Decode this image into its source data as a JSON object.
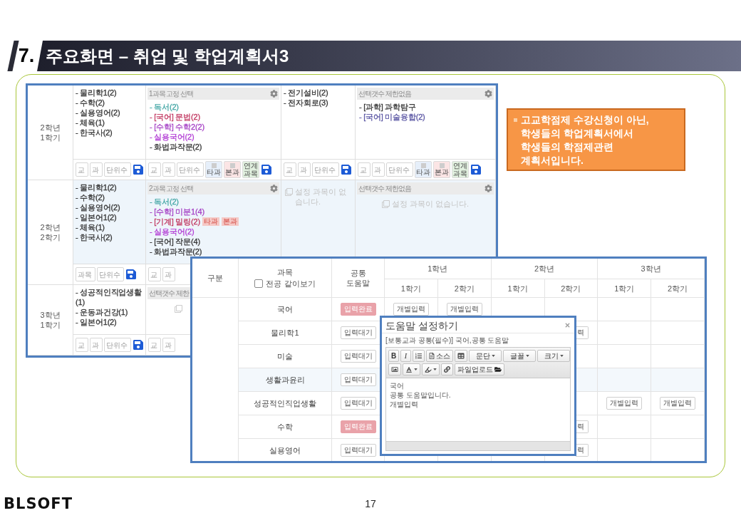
{
  "title": {
    "number": "7.",
    "text": "주요화면 – 취업 및 학업계획서3"
  },
  "planner": {
    "rows": [
      {
        "label": "2학년 1학기",
        "selected": false,
        "cells": [
          {
            "kind": "list",
            "items": [
              {
                "text": "- 물리학1(2)"
              },
              {
                "text": "- 수학(2)"
              },
              {
                "text": "- 실용영어(2)"
              },
              {
                "text": "- 체육(1)"
              },
              {
                "text": "- 한국사(2)"
              }
            ],
            "tools": [
              {
                "kind": "input",
                "placeholder": "교"
              },
              {
                "kind": "input",
                "placeholder": "과"
              },
              {
                "kind": "input",
                "placeholder": "단위수"
              },
              {
                "kind": "save"
              }
            ]
          },
          {
            "kind": "group",
            "header": "1과목 고정 선택",
            "items": [
              {
                "text": "- 독서(2)",
                "color": "#45a7a6"
              },
              {
                "text": "- [국어] 문법(2)",
                "color": "#c0355f"
              },
              {
                "text": "- [수학] 수학2(2)",
                "color": "#a43fc4"
              },
              {
                "text": "- 실용국어(2)",
                "color": "#b13cd4"
              },
              {
                "text": "- 화법과작문(2)",
                "color": "#333333"
              }
            ],
            "tools": [
              {
                "kind": "input",
                "placeholder": "교"
              },
              {
                "kind": "input",
                "placeholder": "과"
              },
              {
                "kind": "input",
                "placeholder": "단위수"
              },
              {
                "kind": "toggle",
                "label": "타과",
                "checked": false,
                "color": "#e6effa"
              },
              {
                "kind": "toggle",
                "label": "본과",
                "checked": false,
                "color": "#fbe5e5"
              },
              {
                "kind": "tag",
                "label": "연계 과목",
                "color": "#e1f0df"
              },
              {
                "kind": "save"
              }
            ]
          },
          {
            "kind": "list",
            "items": [
              {
                "text": "- 전기설비(2)"
              },
              {
                "text": "- 전자회로(3)"
              }
            ],
            "tools": [
              {
                "kind": "input",
                "placeholder": "교"
              },
              {
                "kind": "input",
                "placeholder": "과"
              },
              {
                "kind": "input",
                "placeholder": "단위수"
              },
              {
                "kind": "save"
              }
            ]
          },
          {
            "kind": "group",
            "header": "선택갯수 제한없음",
            "items": [
              {
                "text": "- [과학] 과학탐구",
                "color": "#333333"
              },
              {
                "text": "- [국어] 미술융합(2)",
                "color": "#5a56a3"
              }
            ],
            "tools": [
              {
                "kind": "input",
                "placeholder": "교"
              },
              {
                "kind": "input",
                "placeholder": "과"
              },
              {
                "kind": "input",
                "placeholder": "단위수"
              },
              {
                "kind": "toggle",
                "label": "타과",
                "checked": false,
                "color": "#e6effa"
              },
              {
                "kind": "toggle",
                "label": "본과",
                "checked": false,
                "color": "#fbe5e5"
              },
              {
                "kind": "tag",
                "label": "연계 과목",
                "color": "#e1f0df"
              },
              {
                "kind": "save"
              }
            ]
          }
        ]
      },
      {
        "label": "2학년 2학기",
        "selected": true,
        "cells": [
          {
            "kind": "list",
            "items": [
              {
                "text": "- 물리학1(2)"
              },
              {
                "text": "- 수학(2)"
              },
              {
                "text": "- 실용영어(2)"
              },
              {
                "text": "- 일본어1(2)"
              },
              {
                "text": "- 체육(1)"
              },
              {
                "text": "- 한국사(2)"
              }
            ],
            "tools": [
              {
                "kind": "input",
                "placeholder": "과목"
              },
              {
                "kind": "input",
                "placeholder": "단위수"
              },
              {
                "kind": "save"
              }
            ]
          },
          {
            "kind": "group",
            "header": "2과목 고정 선택",
            "items": [
              {
                "text": "- 독서(2)",
                "color": "#45a7a6"
              },
              {
                "text": "- [수학] 미분1(4)",
                "color": "#a43fc4"
              },
              {
                "text": "- [기계] 밀링(2)",
                "color": "#c0355f",
                "badges": [
                  "타과",
                  "본과"
                ]
              },
              {
                "text": "- 실용국어(2)",
                "color": "#b13cd4"
              },
              {
                "text": "- [국어] 작문(4)",
                "color": "#333333"
              },
              {
                "text": "- 화법과작문(2)",
                "color": "#333333"
              }
            ],
            "tools": [
              {
                "kind": "input",
                "placeholder": "교"
              },
              {
                "kind": "input",
                "placeholder": "과"
              }
            ]
          },
          {
            "kind": "empty",
            "message": "설정 과목이 없습니다."
          },
          {
            "kind": "group",
            "header": "선택갯수 제한없음",
            "message": "설정 과목이 없습니다."
          }
        ]
      },
      {
        "label": "3학년 1학기",
        "selected": false,
        "cells": [
          {
            "kind": "list",
            "items": [
              {
                "text": "- 성공적인직업생활(1)"
              },
              {
                "text": "- 운동과건강(1)"
              },
              {
                "text": "- 일본어1(2)"
              }
            ],
            "tools": [
              {
                "kind": "input",
                "placeholder": "교"
              },
              {
                "kind": "input",
                "placeholder": "과"
              },
              {
                "kind": "input",
                "placeholder": "단위수"
              },
              {
                "kind": "save"
              }
            ]
          },
          {
            "kind": "partial",
            "header": "선택갯수 제한",
            "empty_icon": true,
            "tools": [
              {
                "kind": "input",
                "placeholder": "교"
              },
              {
                "kind": "input",
                "placeholder": "과"
              }
            ]
          }
        ]
      }
    ]
  },
  "callout": {
    "text": "고교학점제 수강신청이 아닌,\n학생들의 학업계획서에서\n학생들의 학점제관련\n계획서입니다."
  },
  "course_table": {
    "header": {
      "division": "구분",
      "subject": "과목",
      "major_toggle": {
        "label": "전공 같이보기",
        "checked": false
      },
      "common_help": "공통 도움말",
      "years": [
        {
          "label": "1학년",
          "terms": [
            "1학기",
            "2학기"
          ]
        },
        {
          "label": "2학년",
          "terms": [
            "1학기",
            "2학기"
          ]
        },
        {
          "label": "3학년",
          "terms": [
            "1학기",
            "2학기"
          ]
        }
      ]
    },
    "rows": [
      {
        "subject": "국어",
        "selected": false,
        "help": {
          "kind": "done",
          "label": "입력완료"
        },
        "terms": {
          "y1t1": {
            "label": "개별입력",
            "clipped": false
          },
          "y1t2": {
            "label": "개별입력",
            "clipped": false
          }
        }
      },
      {
        "subject": "물리학1",
        "selected": false,
        "help": {
          "kind": "waiting",
          "label": "입력대기"
        },
        "terms": {
          "y2t2": {
            "label": "력",
            "clipped": true
          }
        }
      },
      {
        "subject": "미술",
        "selected": false,
        "help": {
          "kind": "waiting",
          "label": "입력대기"
        }
      },
      {
        "subject": "생활과윤리",
        "selected": true,
        "help": {
          "kind": "waiting",
          "label": "입력대기"
        }
      },
      {
        "subject": "성공적인직업생활",
        "selected": false,
        "help": {
          "kind": "waiting",
          "label": "입력대기"
        },
        "terms": {
          "y3t1": {
            "label": "개별입력",
            "clipped": false
          },
          "y3t2": {
            "label": "개별입력",
            "clipped": false
          }
        }
      },
      {
        "subject": "수학",
        "selected": false,
        "help": {
          "kind": "done",
          "label": "입력완료"
        },
        "terms": {
          "y2t2": {
            "label": "력",
            "clipped": true
          }
        }
      },
      {
        "subject": "실용영어",
        "selected": false,
        "help": {
          "kind": "waiting",
          "label": "입력대기"
        },
        "terms": {
          "y2t2": {
            "label": "력",
            "clipped": true
          }
        }
      }
    ]
  },
  "dialog": {
    "title": "도움말 설정하기",
    "subtitle": "[보통교과 공통(필수)] 국어,공통 도움말",
    "toolbar": [
      [
        {
          "kind": "bold",
          "label": "B"
        },
        {
          "kind": "italic",
          "label": "I"
        },
        {
          "kind": "numbered-list"
        },
        {
          "kind": "source",
          "label": "소스"
        },
        {
          "kind": "table"
        },
        {
          "kind": "dropdown",
          "label": "문단"
        },
        {
          "kind": "dropdown",
          "label": "글꼴"
        },
        {
          "kind": "dropdown",
          "label": "크기"
        }
      ],
      [
        {
          "kind": "image"
        },
        {
          "kind": "text-color"
        },
        {
          "kind": "highlight-color"
        },
        {
          "kind": "link"
        },
        {
          "kind": "upload",
          "label": "파일업로드"
        }
      ]
    ],
    "content": "국어\n공통 도움말입니다.\n개별입력"
  },
  "footer": {
    "logo": "BLSOFT",
    "page": "17"
  }
}
